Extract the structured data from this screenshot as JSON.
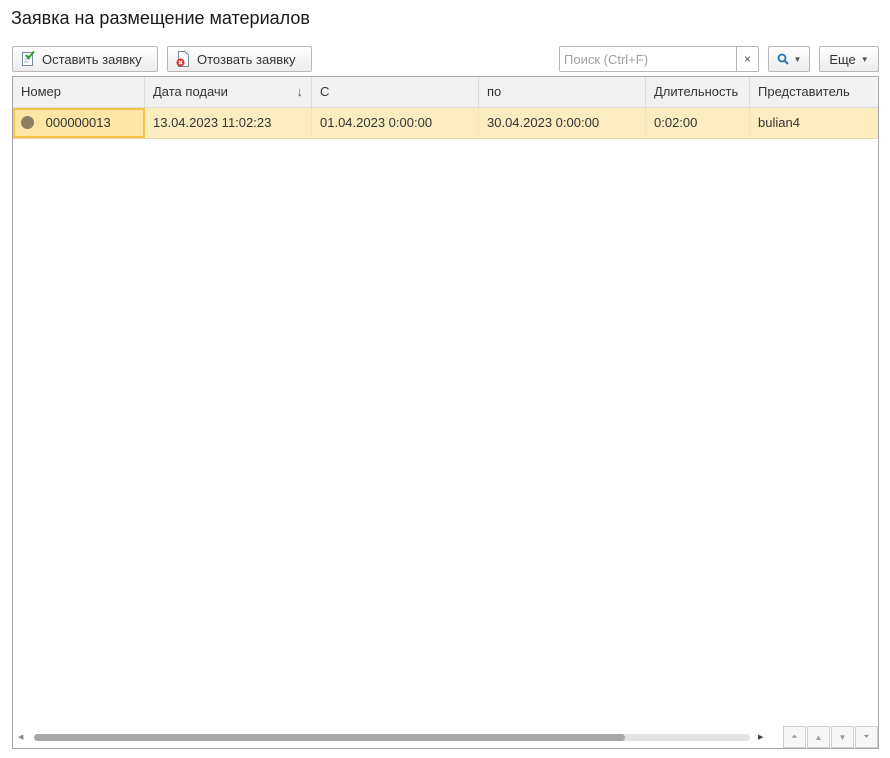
{
  "page": {
    "title": "Заявка на размещение материалов"
  },
  "toolbar": {
    "leave_request_label": "Оставить заявку",
    "leave_request_icon": "document-check-icon",
    "revoke_request_label": "Отозвать заявку",
    "revoke_request_icon": "document-delete-icon",
    "search_placeholder": "Поиск (Ctrl+F)",
    "search_value": "",
    "clear_label": "×",
    "find_icon": "magnifier-icon",
    "more_label": "Еще"
  },
  "table": {
    "columns": [
      "Номер",
      "Дата подачи",
      "С",
      "по",
      "Длительность",
      "Представитель"
    ],
    "sort_indicator": "↓",
    "rows": [
      {
        "status_icon": "gray-circle-icon",
        "number": "000000013",
        "submitted": "13.04.2023 11:02:23",
        "from": "01.04.2023 0:00:00",
        "to": "30.04.2023 0:00:00",
        "duration": "0:02:00",
        "representative": "bulian4"
      }
    ]
  },
  "colors": {
    "selected_row": "#fbedbf",
    "selected_cell_border": "#f3c24a",
    "header_bg": "#f2f2f2"
  }
}
